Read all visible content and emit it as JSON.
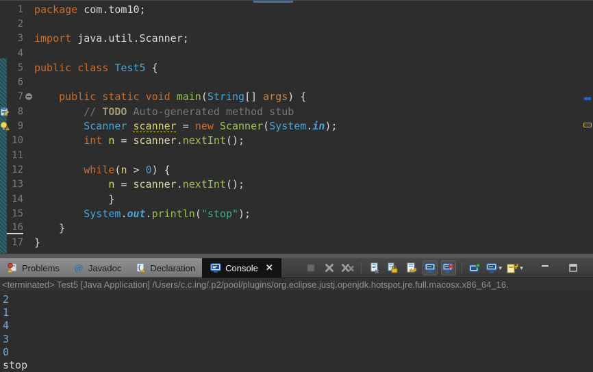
{
  "colors": {
    "editor_background": "#2d2d2d",
    "keyword": "#cb6d2e",
    "type": "#45a5db",
    "method": "#9cc44e",
    "string": "#3bb08a",
    "number_literal": "#5f97cb",
    "variable": "#ded766",
    "comment": "#73797d",
    "stdin_text": "#7ba3d6",
    "tab_bar": "#808284",
    "active_tab_background": "#131313",
    "occurrence_marker": "#2d64b5",
    "warning_marker": "#c9ae35",
    "tab_edge_indicator": "#3a72b4"
  },
  "editor": {
    "lines": [
      {
        "num": "1",
        "tokens": [
          [
            "package",
            "kw"
          ],
          [
            " com.tom10;",
            "plain"
          ]
        ]
      },
      {
        "num": "2",
        "tokens": []
      },
      {
        "num": "3",
        "tokens": [
          [
            "import",
            "kw"
          ],
          [
            " java.util.Scanner;",
            "plain"
          ]
        ]
      },
      {
        "num": "4",
        "tokens": []
      },
      {
        "num": "5",
        "tokens": [
          [
            "public",
            "kw"
          ],
          [
            " ",
            "plain"
          ],
          [
            "class",
            "kw"
          ],
          [
            " ",
            "plain"
          ],
          [
            "Test5",
            "type"
          ],
          [
            " {",
            "plain"
          ]
        ]
      },
      {
        "num": "6",
        "tokens": []
      },
      {
        "num": "7",
        "fold": true,
        "tokens": [
          [
            "    ",
            "plain"
          ],
          [
            "public",
            "kw"
          ],
          [
            " ",
            "plain"
          ],
          [
            "static",
            "kw"
          ],
          [
            " ",
            "plain"
          ],
          [
            "void",
            "kw"
          ],
          [
            " ",
            "plain"
          ],
          [
            "main",
            "method"
          ],
          [
            "(",
            "plain"
          ],
          [
            "String",
            "type"
          ],
          [
            "[] ",
            "plain"
          ],
          [
            "args",
            "param"
          ],
          [
            ") {",
            "plain"
          ]
        ]
      },
      {
        "num": "8",
        "gutter_icon": "task-icon",
        "tokens": [
          [
            "        ",
            "plain"
          ],
          [
            "// ",
            "cmt"
          ],
          [
            "TODO",
            "todo"
          ],
          [
            " Auto-generated method stub",
            "cmt"
          ]
        ]
      },
      {
        "num": "9",
        "gutter_icon": "warning-bulb-icon",
        "tokens": [
          [
            "        ",
            "plain"
          ],
          [
            "Scanner",
            "type"
          ],
          [
            " ",
            "plain"
          ],
          [
            "scanner",
            "varwarn"
          ],
          [
            " = ",
            "plain"
          ],
          [
            "new",
            "kw"
          ],
          [
            " ",
            "plain"
          ],
          [
            "Scanner",
            "method"
          ],
          [
            "(",
            "plain"
          ],
          [
            "System",
            "type"
          ],
          [
            ".",
            "plain"
          ],
          [
            "in",
            "field"
          ],
          [
            ");",
            "plain"
          ]
        ]
      },
      {
        "num": "10",
        "tokens": [
          [
            "        ",
            "plain"
          ],
          [
            "int",
            "kw"
          ],
          [
            " ",
            "plain"
          ],
          [
            "n",
            "var"
          ],
          [
            " = ",
            "plain"
          ],
          [
            "scanner",
            "varref"
          ],
          [
            ".",
            "plain"
          ],
          [
            "nextInt",
            "method"
          ],
          [
            "();",
            "plain"
          ]
        ]
      },
      {
        "num": "11",
        "tokens": []
      },
      {
        "num": "12",
        "tokens": [
          [
            "        ",
            "plain"
          ],
          [
            "while",
            "kw"
          ],
          [
            "(",
            "plain"
          ],
          [
            "n",
            "var"
          ],
          [
            " > ",
            "plain"
          ],
          [
            "0",
            "num"
          ],
          [
            ") {",
            "plain"
          ]
        ]
      },
      {
        "num": "13",
        "tokens": [
          [
            "            ",
            "plain"
          ],
          [
            "n",
            "var"
          ],
          [
            " = ",
            "plain"
          ],
          [
            "scanner",
            "varref"
          ],
          [
            ".",
            "plain"
          ],
          [
            "nextInt",
            "method"
          ],
          [
            "();",
            "plain"
          ]
        ]
      },
      {
        "num": "14",
        "tokens": [
          [
            "            }",
            "plain"
          ]
        ]
      },
      {
        "num": "15",
        "tokens": [
          [
            "        ",
            "plain"
          ],
          [
            "System",
            "type"
          ],
          [
            ".",
            "plain"
          ],
          [
            "out",
            "field"
          ],
          [
            ".",
            "plain"
          ],
          [
            "println",
            "method"
          ],
          [
            "(",
            "plain"
          ],
          [
            "\"stop\"",
            "str"
          ],
          [
            ");",
            "plain"
          ]
        ]
      },
      {
        "num": "16",
        "underline_num": true,
        "tokens": [
          [
            "    }",
            "plain"
          ]
        ]
      },
      {
        "num": "17",
        "tokens": [
          [
            "}",
            "plain"
          ]
        ]
      }
    ],
    "ruler_markers": [
      {
        "name": "occurrence-marker",
        "kind": "occ"
      },
      {
        "name": "warning-marker",
        "kind": "warn"
      }
    ]
  },
  "bottom_panel": {
    "tabs": [
      {
        "label": "Problems",
        "icon": "problems-icon",
        "active": false
      },
      {
        "label": "Javadoc",
        "icon": "javadoc-icon",
        "active": false
      },
      {
        "label": "Declaration",
        "icon": "declaration-icon",
        "active": false
      },
      {
        "label": "Console",
        "icon": "console-icon",
        "active": true,
        "closable": true
      }
    ],
    "close_glyph": "✕",
    "dropdown_glyph": "▼",
    "toolbar": [
      {
        "name": "terminate-button",
        "icon": "terminate-icon",
        "disabled": true
      },
      {
        "name": "remove-launch-button",
        "icon": "remove-launch-icon"
      },
      {
        "name": "remove-all-launches-button",
        "icon": "remove-all-icon"
      },
      {
        "sep": true
      },
      {
        "name": "clear-console-button",
        "icon": "clear-console-icon"
      },
      {
        "name": "scroll-lock-button",
        "icon": "scroll-lock-icon"
      },
      {
        "name": "word-wrap-button",
        "icon": "word-wrap-icon"
      },
      {
        "name": "show-stdout-button",
        "icon": "show-stdout-icon",
        "toggled": true
      },
      {
        "name": "show-stderr-button",
        "icon": "show-stderr-icon",
        "toggled": true
      },
      {
        "sep": true
      },
      {
        "name": "pin-console-button",
        "icon": "pin-console-icon"
      },
      {
        "name": "display-console-button",
        "icon": "display-console-icon",
        "dropdown": true
      },
      {
        "name": "open-console-button",
        "icon": "open-console-icon",
        "dropdown": true
      },
      {
        "name": "minimize-button",
        "icon": "minimize-icon",
        "gap_before": true
      },
      {
        "name": "maximize-button",
        "icon": "maximize-icon",
        "gap_before": true
      }
    ]
  },
  "console": {
    "status_line": "<terminated> Test5 [Java Application] /Users/c.c.ing/.p2/pool/plugins/org.eclipse.justj.openjdk.hotspot.jre.full.macosx.x86_64_16.",
    "lines": [
      {
        "text": "2",
        "kind": "stdin"
      },
      {
        "text": "1",
        "kind": "stdin"
      },
      {
        "text": "4",
        "kind": "stdin"
      },
      {
        "text": "3",
        "kind": "stdin"
      },
      {
        "text": "0",
        "kind": "stdin"
      },
      {
        "text": "stop",
        "kind": "stdout"
      }
    ]
  }
}
